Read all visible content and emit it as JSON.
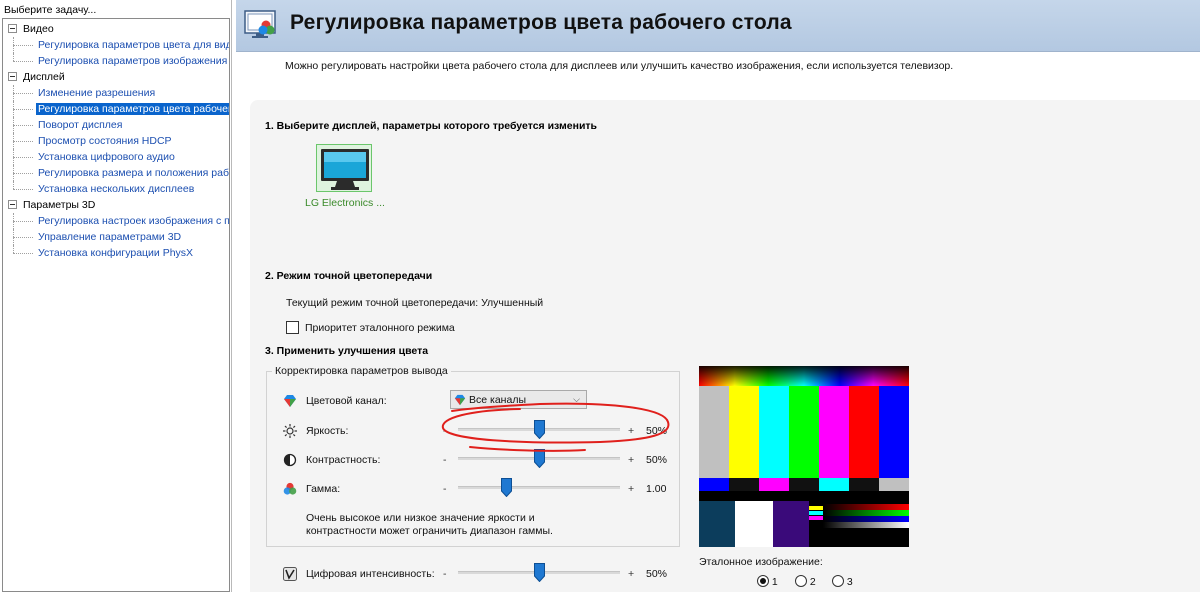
{
  "left_panel": {
    "header": "Выберите задачу...",
    "categories": [
      {
        "label": "Видео",
        "items": [
          {
            "label": "Регулировка параметров цвета для вид"
          },
          {
            "label": "Регулировка параметров изображения"
          }
        ]
      },
      {
        "label": "Дисплей",
        "items": [
          {
            "label": "Изменение разрешения"
          },
          {
            "label": "Регулировка параметров цвета рабочег",
            "selected": true
          },
          {
            "label": "Поворот дисплея"
          },
          {
            "label": "Просмотр состояния HDCP"
          },
          {
            "label": "Установка цифрового аудио"
          },
          {
            "label": "Регулировка размера и положения рабо"
          },
          {
            "label": "Установка нескольких дисплеев"
          }
        ]
      },
      {
        "label": "Параметры 3D",
        "items": [
          {
            "label": "Регулировка настроек изображения с п"
          },
          {
            "label": "Управление параметрами 3D"
          },
          {
            "label": "Установка конфигурации PhysX"
          }
        ]
      }
    ]
  },
  "header": {
    "title": "Регулировка параметров цвета рабочего стола",
    "description": "Можно регулировать настройки цвета рабочего стола для дисплеев или улучшить качество изображения, если используется телевизор."
  },
  "section1": {
    "title": "1. Выберите дисплей, параметры которого требуется изменить",
    "display_name": "LG Electronics ..."
  },
  "section2": {
    "title": "2. Режим точной цветопередачи",
    "current_mode": "Текущий режим точной цветопередачи: Улучшенный",
    "checkbox_label": "Приоритет эталонного режима",
    "checkbox_checked": false
  },
  "section3": {
    "title": "3. Применить улучшения цвета",
    "group_title": "Корректировка параметров вывода",
    "channel_label": "Цветовой канал:",
    "channel_value": "Все каналы",
    "minus": "-",
    "plus": "+",
    "brightness": {
      "label": "Яркость:",
      "value": "50%",
      "fraction": 0.5
    },
    "contrast": {
      "label": "Контрастность:",
      "value": "50%",
      "fraction": 0.5
    },
    "gamma": {
      "label": "Гамма:",
      "value": "1.00",
      "fraction": 0.3
    },
    "warning_line1": "Очень высокое или низкое значение яркости и",
    "warning_line2": "контрастности может ограничить диапазон гаммы.",
    "digital_vibrance": {
      "label": "Цифровая интенсивность:",
      "value": "50%",
      "fraction": 0.5
    }
  },
  "reference": {
    "label": "Эталонное изображение:",
    "options": [
      "1",
      "2",
      "3"
    ],
    "selected": "1"
  },
  "colors": {
    "selection": "#0a64cc",
    "link": "#1c4fb0",
    "slider_thumb": "#1f78d1",
    "annotation": "#e0201c"
  }
}
